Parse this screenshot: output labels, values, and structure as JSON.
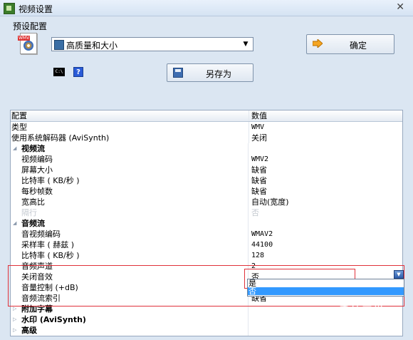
{
  "window": {
    "title": "视频设置",
    "close_glyph": "✕"
  },
  "preset": {
    "label": "预设配置",
    "selected": "高质量和大小",
    "icon_tag": "WMV"
  },
  "buttons": {
    "ok": "确定",
    "save_as": "另存为"
  },
  "cmd_icon_text": "C:\\",
  "help_icon_text": "?",
  "grid": {
    "header": {
      "name": "配置",
      "value": "数值"
    },
    "rows": [
      {
        "name": "类型",
        "value": "WMV"
      },
      {
        "name": "使用系统解码器 (AviSynth)",
        "value": "关闭"
      },
      {
        "name": "视频流",
        "value": ""
      },
      {
        "name": "视频编码",
        "value": "WMV2"
      },
      {
        "name": "屏幕大小",
        "value": "缺省"
      },
      {
        "name": "比特率 ( KB/秒 )",
        "value": "缺省"
      },
      {
        "name": "每秒帧数",
        "value": "缺省"
      },
      {
        "name": "宽高比",
        "value": "自动(宽度)"
      },
      {
        "name": "隔行",
        "value": "否"
      },
      {
        "name": "音频流",
        "value": ""
      },
      {
        "name": "音视频编码",
        "value": "WMAV2"
      },
      {
        "name": "采样率 ( 赫兹 )",
        "value": "44100"
      },
      {
        "name": "比特率 ( KB/秒 )",
        "value": "128"
      },
      {
        "name": "音频声道",
        "value": "2"
      },
      {
        "name": "关闭音效",
        "value": "否"
      },
      {
        "name": "音量控制 (+dB)",
        "value": ""
      },
      {
        "name": "音频流索引",
        "value": "缺省"
      },
      {
        "name": "附加字幕",
        "value": ""
      },
      {
        "name": "水印 (AviSynth)",
        "value": ""
      },
      {
        "name": "高级",
        "value": ""
      }
    ]
  },
  "dropdown": {
    "options": [
      "是",
      "否"
    ],
    "selected_index": 1
  },
  "watermark": {
    "cn": "系统天堂",
    "en": "xpgod"
  },
  "colors": {
    "highlight": "#3399ff",
    "annotation": "#e0313a"
  }
}
